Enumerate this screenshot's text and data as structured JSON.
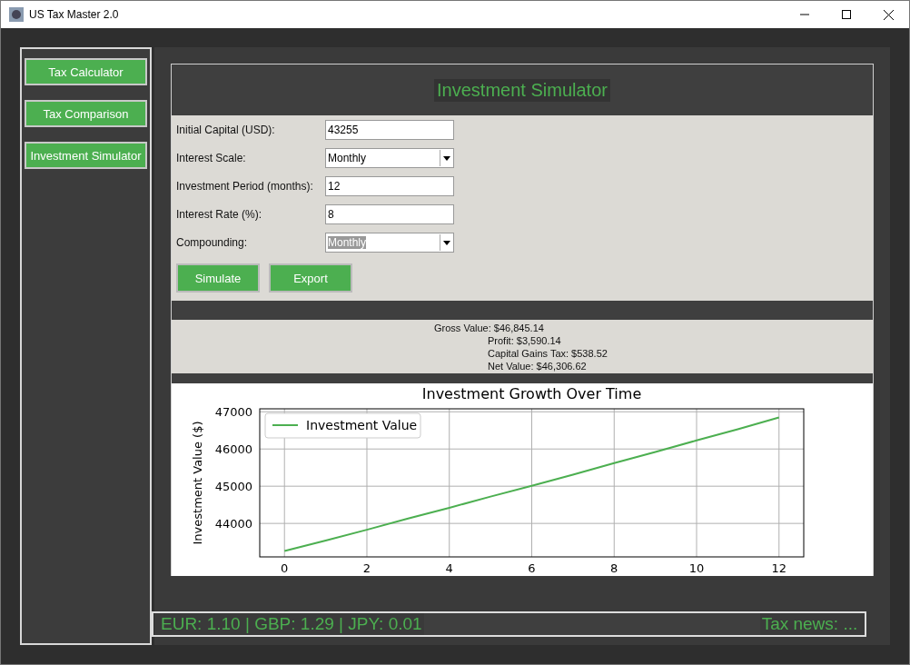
{
  "window": {
    "title": "US Tax Master 2.0"
  },
  "sidebar": {
    "items": [
      {
        "label": "Tax Calculator"
      },
      {
        "label": "Tax Comparison"
      },
      {
        "label": "Investment Simulator"
      }
    ]
  },
  "page": {
    "title": "Investment Simulator"
  },
  "form": {
    "fields": [
      {
        "label": "Initial Capital (USD):",
        "kind": "text",
        "value": "43255",
        "focused": false
      },
      {
        "label": "Interest Scale:",
        "kind": "combo",
        "value": "Monthly",
        "focused": false
      },
      {
        "label": "Investment Period (months):",
        "kind": "text",
        "value": "12",
        "focused": false
      },
      {
        "label": "Interest Rate (%):",
        "kind": "text",
        "value": "8",
        "focused": false
      },
      {
        "label": "Compounding:",
        "kind": "combo",
        "value": "Monthly",
        "focused": true
      }
    ],
    "buttons": [
      "Simulate",
      "Export"
    ]
  },
  "results": [
    "Gross Value: $46,845.14",
    "Profit: $3,590.14",
    "Capital Gains Tax: $538.52",
    "Net Value: $46,306.62"
  ],
  "chart_data": {
    "type": "line",
    "title": "Investment Growth Over Time",
    "ylabel": "Investment Value ($)",
    "x": [
      0,
      1,
      2,
      3,
      4,
      5,
      6,
      7,
      8,
      9,
      10,
      11,
      12
    ],
    "series": [
      {
        "name": "Investment Value",
        "color": "#4caf50",
        "values": [
          43260,
          43540,
          43830,
          44130,
          44420,
          44720,
          45010,
          45310,
          45620,
          45920,
          46230,
          46530,
          46850
        ]
      }
    ],
    "grid": true,
    "xlim": [
      -0.6,
      12.6
    ],
    "ylim": [
      43100,
      47080
    ],
    "xticks": [
      0,
      2,
      4,
      6,
      8,
      10,
      12
    ],
    "yticks": [
      44000,
      45000,
      46000,
      47000
    ]
  },
  "status_bar": {
    "rates": "EUR: 1.10 | GBP: 1.29 | JPY: 0.01",
    "news": "Tax news: ..."
  }
}
